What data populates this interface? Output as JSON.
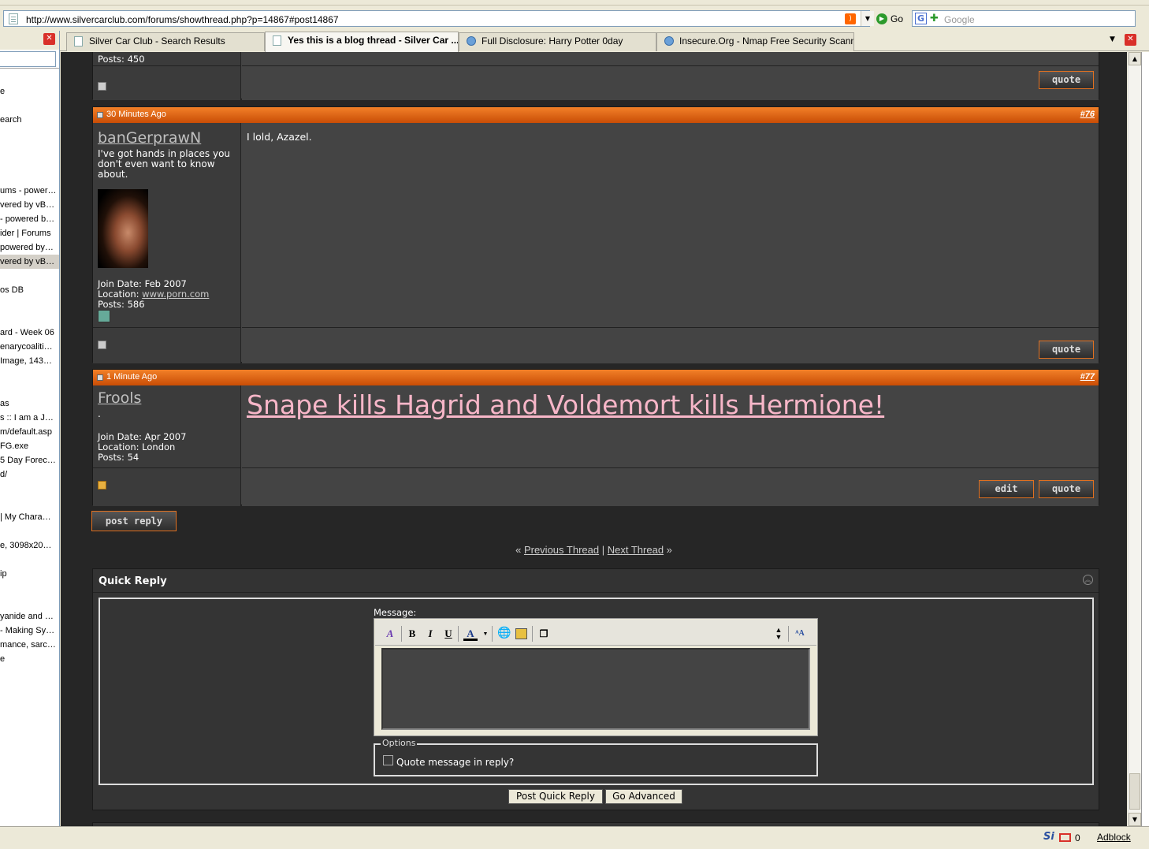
{
  "browser": {
    "url": "http://www.silvercarclub.com/forums/showthread.php?p=14867#post14867",
    "go_label": "Go",
    "search_placeholder": "Google",
    "tabs": [
      {
        "label": "Silver Car Club - Search Results"
      },
      {
        "label": "Yes this is a blog thread - Silver Car ..."
      },
      {
        "label": "Full Disclosure: Harry Potter 0day"
      },
      {
        "label": "Insecure.Org - Nmap Free Security Scann..."
      }
    ],
    "status_mail_count": "0",
    "adblock_label": "Adblock"
  },
  "sidebar": {
    "items": [
      {
        "label": "e"
      },
      {
        "label": "earch"
      },
      {
        "label": "ums - power…"
      },
      {
        "label": "vered by vB…"
      },
      {
        "label": "- powered b…"
      },
      {
        "label": "ider | Forums"
      },
      {
        "label": "powered by…"
      },
      {
        "label": "vered by vB…"
      },
      {
        "label": "os DB"
      },
      {
        "label": "ard - Week 06"
      },
      {
        "label": "enarycoaliti…"
      },
      {
        "label": "Image, 143…"
      },
      {
        "label": "as"
      },
      {
        "label": "s :: I am a J…"
      },
      {
        "label": "m/default.asp"
      },
      {
        "label": "FG.exe"
      },
      {
        "label": "5 Day Forec…"
      },
      {
        "label": "d/"
      },
      {
        "label": "| My Chara…"
      },
      {
        "label": "e, 3098x20…"
      },
      {
        "label": "ip"
      },
      {
        "label": "yanide and …"
      },
      {
        "label": "- Making Sy…"
      },
      {
        "label": "mance, sarc…"
      },
      {
        "label": "e"
      }
    ]
  },
  "prev_post": {
    "posts_line": "Posts: 450",
    "quote_label": "quote"
  },
  "post76": {
    "date": "30 Minutes Ago",
    "number": "#76",
    "username": "banGerprawN",
    "user_title": "I've got hands in places you don't even want to know about.",
    "join_date": "Join Date: Feb 2007",
    "location_label": "Location: ",
    "location_link": "www.porn.com",
    "posts": "Posts: 586",
    "message": "I lold, Azazel.",
    "quote_label": "quote"
  },
  "post77": {
    "date": "1 Minute Ago",
    "number": "#77",
    "username": "Frools",
    "user_title": ".",
    "join_date": "Join Date: Apr 2007",
    "location": "Location: London",
    "posts": "Posts: 54",
    "message": "Snape kills Hagrid and Voldemort kills Hermione!",
    "edit_label": "edit",
    "quote_label": "quote"
  },
  "post_reply_label": "post reply",
  "thread_nav": {
    "open": "«",
    "prev": "Previous Thread",
    "sep": "|",
    "next": "Next Thread",
    "close": "»"
  },
  "quick_reply": {
    "title": "Quick Reply",
    "message_label": "Message:",
    "options_legend": "Options",
    "quote_option": "Quote message in reply?",
    "submit_label": "Post Quick Reply",
    "advanced_label": "Go Advanced"
  }
}
